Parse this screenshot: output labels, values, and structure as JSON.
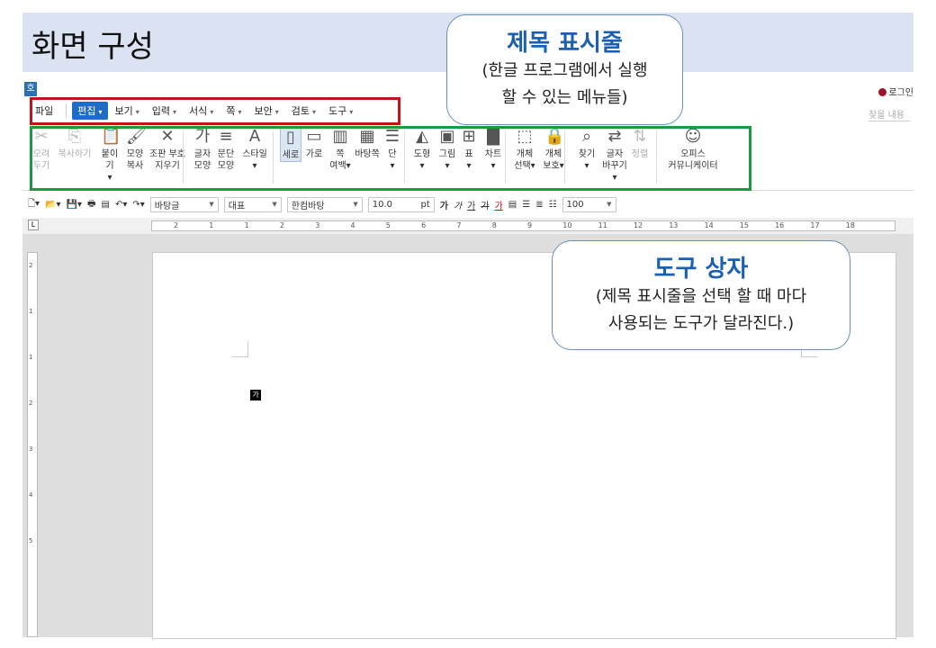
{
  "header": {
    "title": "화면 구성"
  },
  "app": {
    "logo": "호",
    "login": "로그인",
    "search_hint": "찾을 내용",
    "menu": [
      {
        "label": "파일",
        "caret": false,
        "active": false
      },
      {
        "label": "편집",
        "caret": true,
        "active": true
      },
      {
        "label": "보기",
        "caret": true,
        "active": false
      },
      {
        "label": "입력",
        "caret": true,
        "active": false
      },
      {
        "label": "서식",
        "caret": true,
        "active": false
      },
      {
        "label": "쪽",
        "caret": true,
        "active": false
      },
      {
        "label": "보안",
        "caret": true,
        "active": false
      },
      {
        "label": "검토",
        "caret": true,
        "active": false
      },
      {
        "label": "도구",
        "caret": true,
        "active": false
      }
    ],
    "ribbon": [
      {
        "l1": "오려",
        "l2": "두기",
        "icon": "✂",
        "disabled": true
      },
      {
        "l1": "복사하기",
        "l2": "",
        "icon": "⎘",
        "disabled": true
      },
      {
        "l1": "붙이기",
        "l2": "▾",
        "icon": "📋",
        "disabled": false
      },
      {
        "l1": "모양",
        "l2": "복사",
        "icon": "🖌",
        "disabled": false
      },
      {
        "l1": "조판 부호",
        "l2": "지우기",
        "icon": "✕",
        "disabled": false
      },
      {
        "l1": "글자",
        "l2": "모양",
        "icon": "가",
        "disabled": false
      },
      {
        "l1": "문단",
        "l2": "모양",
        "icon": "≡",
        "disabled": false
      },
      {
        "l1": "스타일",
        "l2": "▾",
        "icon": "A",
        "disabled": false
      },
      {
        "l1": "세로",
        "l2": "",
        "icon": "▯",
        "disabled": false
      },
      {
        "l1": "가로",
        "l2": "",
        "icon": "▭",
        "disabled": false
      },
      {
        "l1": "쪽",
        "l2": "여백▾",
        "icon": "▥",
        "disabled": false
      },
      {
        "l1": "바탕쪽",
        "l2": "",
        "icon": "▦",
        "disabled": false
      },
      {
        "l1": "단",
        "l2": "▾",
        "icon": "☰",
        "disabled": false
      },
      {
        "l1": "도형",
        "l2": "▾",
        "icon": "◭",
        "disabled": false
      },
      {
        "l1": "그림",
        "l2": "▾",
        "icon": "▣",
        "disabled": false
      },
      {
        "l1": "표",
        "l2": "▾",
        "icon": "⊞",
        "disabled": false
      },
      {
        "l1": "차트",
        "l2": "▾",
        "icon": "▇",
        "disabled": false
      },
      {
        "l1": "개체",
        "l2": "선택▾",
        "icon": "⬚",
        "disabled": false
      },
      {
        "l1": "개체",
        "l2": "보호▾",
        "icon": "🔒",
        "disabled": false
      },
      {
        "l1": "찾기",
        "l2": "▾",
        "icon": "⌕",
        "disabled": false
      },
      {
        "l1": "글자",
        "l2": "바꾸기▾",
        "icon": "⇄",
        "disabled": false
      },
      {
        "l1": "정렬",
        "l2": "",
        "icon": "⇅",
        "disabled": true
      },
      {
        "l1": "오피스",
        "l2": "커뮤니케이터",
        "icon": "☺",
        "disabled": false
      }
    ],
    "format": {
      "style": "바탕글",
      "lang": "대표",
      "font": "한컴바탕",
      "size": "10.0",
      "unit": "pt",
      "bold": "가",
      "italic": "가",
      "underline": "가",
      "strike": "가",
      "color": "가",
      "zoom": "100"
    },
    "ruler_ticks": [
      "2",
      "1",
      "1",
      "2",
      "3",
      "4",
      "5",
      "6",
      "7",
      "8",
      "9",
      "10",
      "11",
      "12",
      "13",
      "14",
      "15",
      "16",
      "17",
      "18"
    ],
    "vruler_ticks": [
      "2",
      "1",
      "1",
      "2",
      "3",
      "4",
      "5"
    ],
    "cursor_char": "가"
  },
  "callouts": [
    {
      "title": "제목 표시줄",
      "lines": [
        "(한글 프로그램에서 실행",
        "할 수 있는 메뉴들)"
      ]
    },
    {
      "title": "도구 상자",
      "lines": [
        "(제목 표시줄을 선택 할 때 마다",
        "사용되는 도구가 달라진다.)"
      ]
    }
  ],
  "colors": {
    "header_bg": "#dbe3f2",
    "menu_box": "#c0151b",
    "ribbon_box": "#1a9a43",
    "callout_title": "#1c5fae",
    "active_menu": "#1f6cc7"
  }
}
